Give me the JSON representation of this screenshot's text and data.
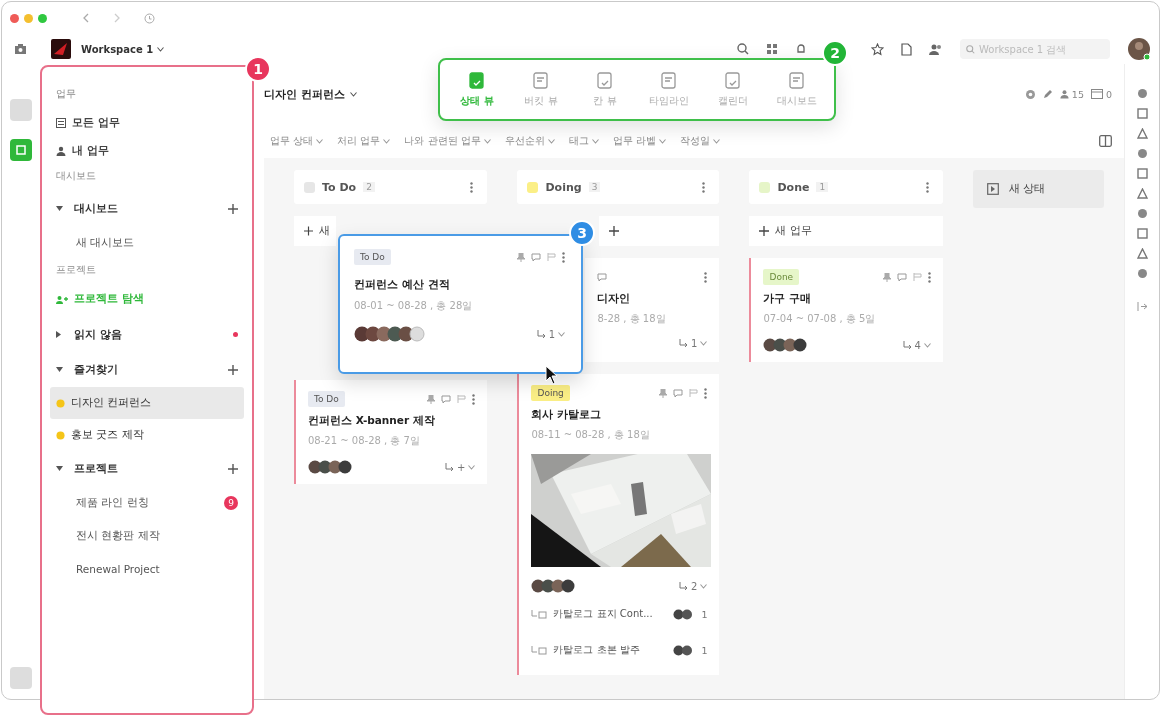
{
  "window": {
    "workspace": "Workspace 1"
  },
  "search": {
    "placeholder": "Workspace 1 검색"
  },
  "sidebar": {
    "items": [
      {
        "kind": "heading",
        "label": "업무"
      },
      {
        "kind": "link",
        "label": "모든 업무"
      },
      {
        "kind": "link",
        "label": "내 업무"
      },
      {
        "kind": "heading",
        "label": "대시보드"
      },
      {
        "kind": "group",
        "label": "대시보드",
        "expanded": true,
        "addable": true
      },
      {
        "kind": "child",
        "label": "새 대시보드",
        "selected": false
      },
      {
        "kind": "heading",
        "label": "프로젝트"
      },
      {
        "kind": "explore",
        "label": "프로젝트 탐색"
      },
      {
        "kind": "group",
        "label": "읽지 않음",
        "expanded": false,
        "alert": true
      },
      {
        "kind": "group",
        "label": "즐겨찾기",
        "expanded": true,
        "addable": true
      },
      {
        "kind": "fav",
        "label": "디자인 컨퍼런스",
        "selected": true
      },
      {
        "kind": "fav",
        "label": "홍보 굿즈 제작",
        "selected": false
      },
      {
        "kind": "group",
        "label": "프로젝트",
        "expanded": true,
        "addable": true
      },
      {
        "kind": "child",
        "label": "제품 라인 런칭",
        "selected": false,
        "badge": "9"
      },
      {
        "kind": "child",
        "label": "전시 현황판 제작",
        "selected": false
      },
      {
        "kind": "child",
        "label": "Renewal Project",
        "selected": false
      }
    ]
  },
  "project": {
    "title": "디자인 컨퍼런스",
    "members": "15",
    "count": "0"
  },
  "views": [
    {
      "label": "상태 뷰",
      "selected": true
    },
    {
      "label": "버킷 뷰",
      "selected": false
    },
    {
      "label": "칸 뷰",
      "selected": false
    },
    {
      "label": "타임라인",
      "selected": false
    },
    {
      "label": "캘린더",
      "selected": false
    },
    {
      "label": "대시보드",
      "selected": false
    }
  ],
  "filters": [
    "업무 상태",
    "처리 업무",
    "나와 관련된 업무",
    "우선순위",
    "태그",
    "업무 라벨",
    "작성일"
  ],
  "columns": [
    {
      "name": "To Do",
      "kind": "todo",
      "count": "2",
      "add_label": "새",
      "drop_slot": true,
      "cards": [
        {
          "tag": "To Do",
          "kind": "todo",
          "title": "컨퍼런스 X-banner 제작",
          "dates": "08-21 ~ 08-28 , 총 7일",
          "subtasks": "+"
        }
      ]
    },
    {
      "name": "Doing",
      "kind": "doing",
      "count": "3",
      "cards": [
        {
          "kind": "partial",
          "title": "디자인",
          "dates": "8-28 , 총 18일",
          "subtasks": "1"
        },
        {
          "tag": "Doing",
          "kind": "doing",
          "title": "회사 카탈로그",
          "dates": "08-11 ~ 08-28 , 총 18일",
          "subtasks": "2",
          "has_picture": true,
          "subitems": [
            {
              "title": "카탈로그 표지 Cont...",
              "count": "1"
            },
            {
              "title": "카탈로그 초본 발주",
              "count": "1"
            }
          ]
        }
      ]
    },
    {
      "name": "Done",
      "kind": "done",
      "count": "1",
      "add_label": "새 업무",
      "cards": [
        {
          "tag": "Done",
          "kind": "done",
          "title": "가구 구매",
          "dates": "07-04 ~ 07-08 , 총 5일",
          "subtasks": "4"
        }
      ]
    }
  ],
  "new_status": {
    "label": "새 상태"
  },
  "floating_card": {
    "tag": "To Do",
    "kind": "todo",
    "title": "컨퍼런스 예산 견적",
    "dates": "08-01 ~ 08-28 , 총 28일",
    "subtasks": "1"
  },
  "callouts": [
    {
      "label": "1",
      "color": "#e8365d"
    },
    {
      "label": "2",
      "color": "#22b537"
    },
    {
      "label": "3",
      "color": "#2f8de4"
    }
  ]
}
